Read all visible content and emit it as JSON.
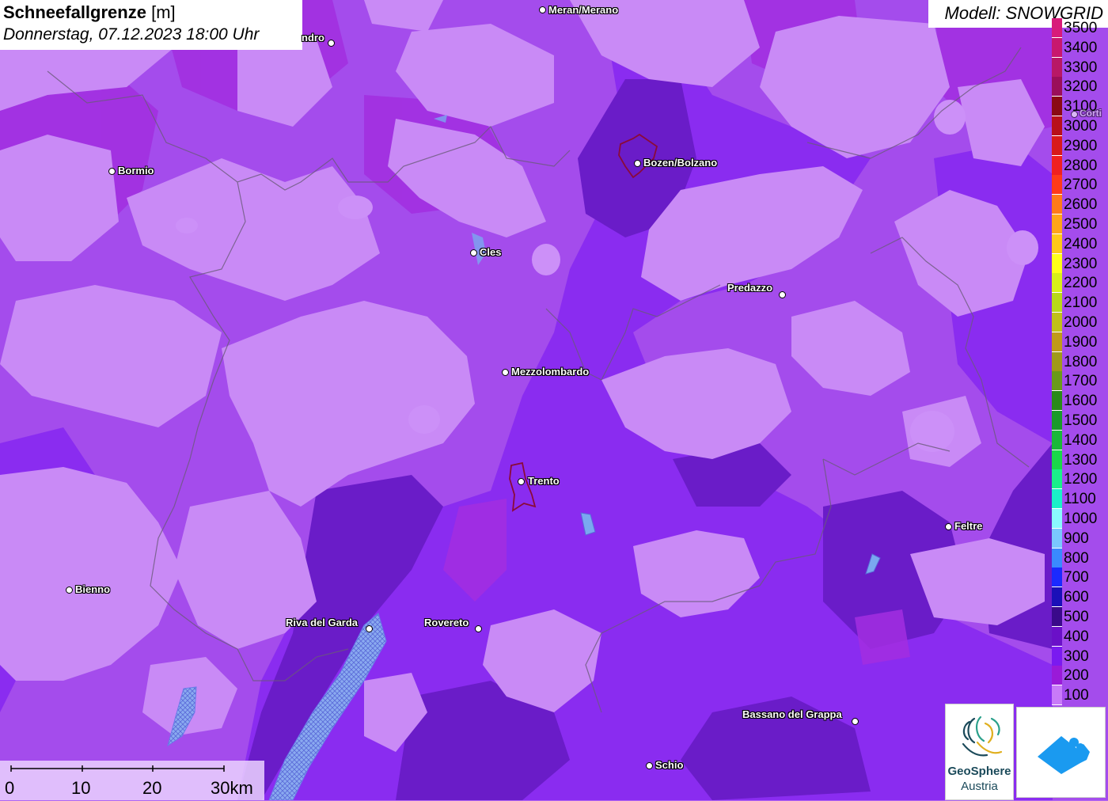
{
  "title": {
    "name": "Schneefallgrenze",
    "unit": "[m]",
    "datetime": "Donnerstag, 07.12.2023 18:00 Uhr"
  },
  "model": "Modell: SNOWGRID",
  "legend": [
    {
      "value": "3500",
      "color": "#d81b7a"
    },
    {
      "value": "3400",
      "color": "#c8186e"
    },
    {
      "value": "3300",
      "color": "#b81866"
    },
    {
      "value": "3200",
      "color": "#9a0f5a"
    },
    {
      "value": "3100",
      "color": "#8a0a14"
    },
    {
      "value": "3000",
      "color": "#b8101a"
    },
    {
      "value": "2900",
      "color": "#d81a1a"
    },
    {
      "value": "2800",
      "color": "#f02020"
    },
    {
      "value": "2700",
      "color": "#ff3a1a"
    },
    {
      "value": "2600",
      "color": "#ff7a1a"
    },
    {
      "value": "2500",
      "color": "#ffa41a"
    },
    {
      "value": "2400",
      "color": "#ffc81a"
    },
    {
      "value": "2300",
      "color": "#ffff1a"
    },
    {
      "value": "2200",
      "color": "#d8f01a"
    },
    {
      "value": "2100",
      "color": "#b8d81a"
    },
    {
      "value": "2000",
      "color": "#c0c01a"
    },
    {
      "value": "1900",
      "color": "#c09a1a"
    },
    {
      "value": "1800",
      "color": "#a09a1a"
    },
    {
      "value": "1700",
      "color": "#6a9a1a"
    },
    {
      "value": "1600",
      "color": "#2a8a1a"
    },
    {
      "value": "1500",
      "color": "#1a9a2a"
    },
    {
      "value": "1400",
      "color": "#1ab83a"
    },
    {
      "value": "1300",
      "color": "#1ad84a"
    },
    {
      "value": "1200",
      "color": "#1af08a"
    },
    {
      "value": "1100",
      "color": "#1af0c8"
    },
    {
      "value": "1000",
      "color": "#8afaff"
    },
    {
      "value": "900",
      "color": "#7ac8ff"
    },
    {
      "value": "800",
      "color": "#3a8aff"
    },
    {
      "value": "700",
      "color": "#1a2aff"
    },
    {
      "value": "600",
      "color": "#1a10b8"
    },
    {
      "value": "500",
      "color": "#3a0a8a"
    },
    {
      "value": "400",
      "color": "#6a10c8"
    },
    {
      "value": "300",
      "color": "#7a1af0"
    },
    {
      "value": "200",
      "color": "#9a1ad8"
    },
    {
      "value": "100",
      "color": "#c87af8"
    }
  ],
  "cities": [
    {
      "name": "Meran/Merano"
    },
    {
      "name": "ndro"
    },
    {
      "name": "Bormio"
    },
    {
      "name": "Bozen/Bolzano"
    },
    {
      "name": "Cles"
    },
    {
      "name": "Predazzo"
    },
    {
      "name": "Mezzolombardo"
    },
    {
      "name": "Trento"
    },
    {
      "name": "Feltre"
    },
    {
      "name": "Bienno"
    },
    {
      "name": "Riva del Garda"
    },
    {
      "name": "Rovereto"
    },
    {
      "name": "Bassano del Grappa"
    },
    {
      "name": "Schio"
    },
    {
      "name": "Corti"
    }
  ],
  "scale": {
    "labels": [
      "0",
      "10",
      "20",
      "30km"
    ]
  },
  "logos": {
    "geosphere_line1": "GeoSphere",
    "geosphere_line2": "Austria"
  },
  "colors": {
    "light_lilac": "#c88af8",
    "mid_purple": "#a84ef0",
    "violet": "#8a2af0",
    "deep_violet": "#6a18d8",
    "dark_purple": "#5a148a",
    "lake": "#7aa8f0",
    "city_outline": "#8a0a3a"
  }
}
